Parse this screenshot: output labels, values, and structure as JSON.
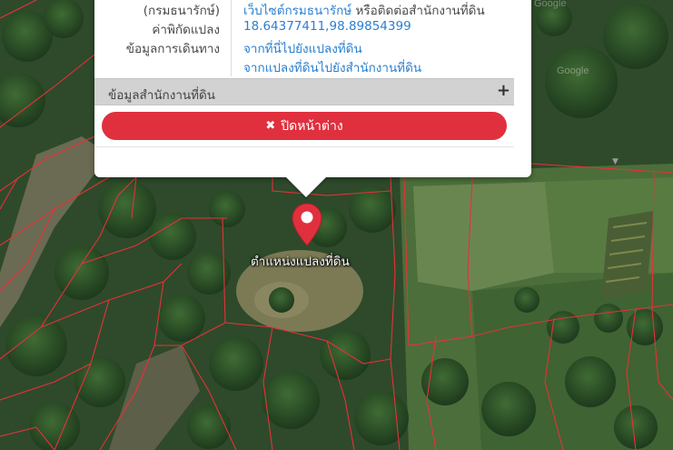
{
  "watermark": "Google",
  "popup": {
    "rows": [
      {
        "label": "(กรมธนารักษ์)",
        "value": "เว็บไซต์กรมธนารักษ์",
        "value_suffix": "หรือติดต่อสำนักงานที่ดิน"
      },
      {
        "label": "ค่าพิกัดแปลง",
        "value": "18.64377411,98.89854399"
      },
      {
        "label": "ข้อมูลการเดินทาง",
        "value": "จากที่นี่ไปยังแปลงที่ดิน",
        "value2": "จากแปลงที่ดินไปยังสำนักงานที่ดิน"
      }
    ],
    "section": {
      "title": "ข้อมูลสำนักงานที่ดิน",
      "icon": "plus-icon",
      "symbol": "+"
    },
    "close_button": {
      "label": "ปิดหน้าต่าง",
      "icon": "close-icon",
      "symbol": "✖"
    }
  },
  "marker": {
    "label": "ตำแหน่งแปลงที่ดิน",
    "icon": "map-pin-icon"
  },
  "colors": {
    "accent_red": "#e0303e",
    "link_blue": "#2a7fd0",
    "parcel_line": "#e8303a"
  }
}
